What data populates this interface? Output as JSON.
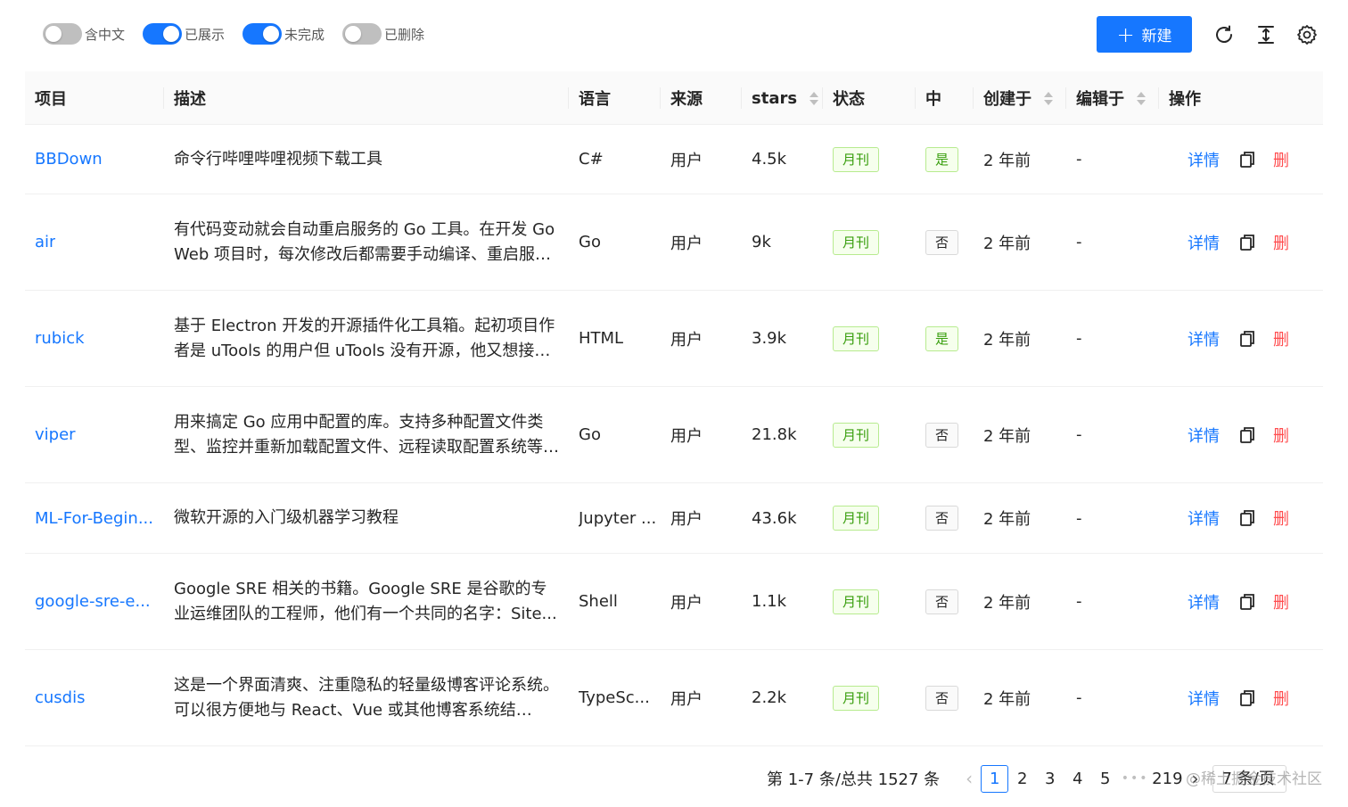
{
  "toolbar": {
    "toggles": [
      {
        "label": "含中文",
        "on": false
      },
      {
        "label": "已展示",
        "on": true
      },
      {
        "label": "未完成",
        "on": true
      },
      {
        "label": "已删除",
        "on": false
      }
    ],
    "new_button": {
      "icon": "plus-icon",
      "label": "新建"
    },
    "icons": [
      "reload-icon",
      "column-height-icon",
      "setting-icon"
    ]
  },
  "table": {
    "columns": [
      {
        "label": "项目",
        "sortable": false
      },
      {
        "label": "描述",
        "sortable": false
      },
      {
        "label": "语言",
        "sortable": false
      },
      {
        "label": "来源",
        "sortable": false
      },
      {
        "label": "stars",
        "sortable": true
      },
      {
        "label": "状态",
        "sortable": false
      },
      {
        "label": "中",
        "sortable": false
      },
      {
        "label": "创建于",
        "sortable": true
      },
      {
        "label": "编辑于",
        "sortable": true
      },
      {
        "label": "操作",
        "sortable": false
      }
    ],
    "rows": [
      {
        "project": "BBDown",
        "desc": "命令行哔哩哔哩视频下载工具",
        "lang": "C#",
        "source": "用户",
        "stars": "4.5k",
        "status": "月刊",
        "zh": "是",
        "created": "2 年前",
        "edited": "-"
      },
      {
        "project": "air",
        "desc": "有代码变动就会自动重启服务的 Go 工具。在开发 Go Web 项目时，每次修改后都需要手动编译、重启服务…",
        "lang": "Go",
        "source": "用户",
        "stars": "9k",
        "status": "月刊",
        "zh": "否",
        "created": "2 年前",
        "edited": "-"
      },
      {
        "project": "rubick",
        "desc": "基于 Electron 开发的开源插件化工具箱。起初项目作者是 uTools 的用户但 uTools 没有开源，他又想接入…",
        "lang": "HTML",
        "source": "用户",
        "stars": "3.9k",
        "status": "月刊",
        "zh": "是",
        "created": "2 年前",
        "edited": "-"
      },
      {
        "project": "viper",
        "desc": "用来搞定 Go 应用中配置的库。支持多种配置文件类型、监控并重新加载配置文件、远程读取配置系统等…",
        "lang": "Go",
        "source": "用户",
        "stars": "21.8k",
        "status": "月刊",
        "zh": "否",
        "created": "2 年前",
        "edited": "-"
      },
      {
        "project": "ML-For-Begin...",
        "desc": "微软开源的入门级机器学习教程",
        "lang": "Jupyter ...",
        "source": "用户",
        "stars": "43.6k",
        "status": "月刊",
        "zh": "否",
        "created": "2 年前",
        "edited": "-"
      },
      {
        "project": "google-sre-e...",
        "desc": "Google SRE 相关的书籍。Google SRE 是谷歌的专业运维团队的工程师，他们有一个共同的名字：Site...",
        "lang": "Shell",
        "source": "用户",
        "stars": "1.1k",
        "status": "月刊",
        "zh": "否",
        "created": "2 年前",
        "edited": "-"
      },
      {
        "project": "cusdis",
        "desc": "这是一个界面清爽、注重隐私的轻量级博客评论系统。可以很方便地与 React、Vue 或其他博客系统结…",
        "lang": "TypeSc...",
        "source": "用户",
        "stars": "2.2k",
        "status": "月刊",
        "zh": "否",
        "created": "2 年前",
        "edited": "-"
      }
    ],
    "actions": {
      "detail": "详情",
      "delete": "删",
      "copy_icon": "copy-icon"
    }
  },
  "pagination": {
    "total_text": "第 1-7 条/总共 1527 条",
    "pages": [
      "1",
      "2",
      "3",
      "4",
      "5"
    ],
    "current": "1",
    "ellipsis": "•••",
    "last_page": "219",
    "page_size": "7 条/页"
  },
  "watermark": "@稀土掘金技术社区",
  "colors": {
    "primary": "#1677ff",
    "danger": "#ff4d4f",
    "success": "#389e0d"
  }
}
